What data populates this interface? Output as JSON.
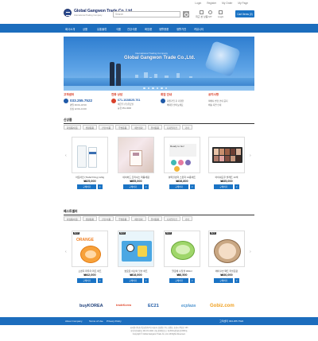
{
  "top_links": [
    "Login",
    "Register",
    "My Order",
    "My Page"
  ],
  "brand": {
    "name": "Global Gangwon Trade Co.,Ltd.",
    "tagline": "International Trading Company"
  },
  "search": {
    "placeholder": "Search"
  },
  "header_utils": [
    "최근 본 상품",
    "MY",
    "Login"
  ],
  "cart_label": "Cart Items (0)",
  "nav": [
    "회사소개",
    "상품",
    "유통물류",
    "식품",
    "건강식품",
    "화장품",
    "생활용품",
    "생활가전",
    "커뮤니티"
  ],
  "banner": {
    "small": "International Trading Company",
    "title": "Global Gangwon Trade Co.,Ltd."
  },
  "info": [
    {
      "title": "고객센터",
      "number": "033.255.7522",
      "lines": [
        "평일 09:00~18:00",
        "점심 12:00~13:00"
      ]
    },
    {
      "title": "전화 상담",
      "number": "671-1028625-761",
      "lines": [
        "예금주 (주)글로벌",
        "농협 351-0000"
      ]
    },
    {
      "title": "회원 안내",
      "number": "",
      "lines": [
        "회원가입 후 다양한",
        "혜택을 받아보세요"
      ]
    },
    {
      "title": "공지사항",
      "number": "",
      "lines": [
        "택배사 변경 안내 공지",
        "배송 지연 안내"
      ]
    }
  ],
  "section1": {
    "title": "신상품",
    "tabs": [
      "화장품/미용",
      "생활용품",
      "건강/식품",
      "주방용품",
      "패션잡화",
      "유아용품",
      "디지털가전",
      "기타"
    ]
  },
  "section2": {
    "title": "베스트셀러",
    "tabs": [
      "화장품/미용",
      "생활용품",
      "건강/식품",
      "주방용품",
      "패션잡화",
      "유아용품",
      "디지털가전",
      "기타"
    ]
  },
  "products_new": [
    {
      "name": "아토마인 (THAHYOng) 120g",
      "price": "₩25,000",
      "btn": "구매하기"
    },
    {
      "name": "네이처드 프리셔스 퍼퓸세럼",
      "price": "₩55,000",
      "btn": "구매하기"
    },
    {
      "name": "뷰티블렌더 스펀지 12종세트",
      "price": "₩38,800",
      "btn": "구매하기"
    },
    {
      "name": "아이섀도우 팔레트 10색",
      "price": "₩35,000",
      "btn": "구매하기"
    }
  ],
  "products_best": [
    {
      "name": "오렌지 파우더 퍼프 세트",
      "price": "₩42,000",
      "btn": "구매하기",
      "tag": "BEST"
    },
    {
      "name": "뽀로로 어린이 칫솔 세트",
      "price": "₩18,000",
      "btn": "구매하기",
      "tag": "BEST"
    },
    {
      "name": "알로에 수딩젤 300ml",
      "price": "₩8,500",
      "btn": "구매하기",
      "tag": "BEST"
    },
    {
      "name": "에어쿠션 팩트 리필포함",
      "price": "₩36,000",
      "btn": "구매하기",
      "tag": "BEST"
    }
  ],
  "partners": [
    "buyKOREA",
    "tradeKorea",
    "EC21",
    "ecplaza",
    "Gobiz.com"
  ],
  "footer": {
    "links": [
      "About Company",
      "Terms of Use",
      "Privacy Policy"
    ],
    "right": "고객센터 033.255.7522",
    "lines": [
      "회사명 (주)글로벌 강원무역 | 대표자 김강원 | 주소 강원도 춘천시 중앙로 123",
      "사업자등록번호 221-81-11111 | 통신판매업신고 제 2019-강원춘천-0000호",
      "Copyright © Global Gangwon Trade Co.,Ltd. All Rights Reserved."
    ]
  },
  "colors": {
    "primary": "#1c6dbd",
    "accent": "#d9412b",
    "navy": "#1d2f6a"
  }
}
